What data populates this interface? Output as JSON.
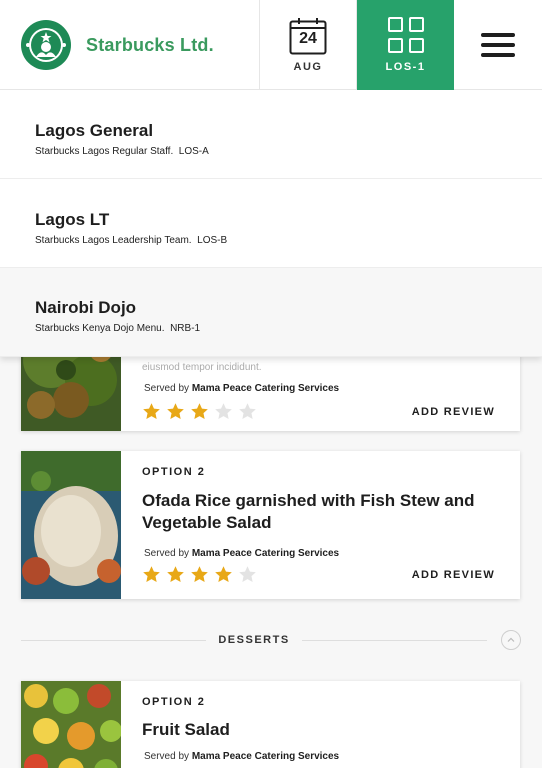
{
  "header": {
    "brand_name": "Starbucks Ltd.",
    "date_day": "24",
    "date_month": "AUG",
    "location_code": "LOS-1",
    "brand_color": "#27a26b"
  },
  "locations": [
    {
      "name": "Lagos General",
      "description": "Starbucks Lagos Regular Staff.",
      "code": "LOS-A"
    },
    {
      "name": "Lagos LT",
      "description": "Starbucks Lagos Leadership Team.",
      "code": "LOS-B"
    },
    {
      "name": "Nairobi Dojo",
      "description": "Starbucks Kenya Dojo Menu.",
      "code": "NRB-1"
    }
  ],
  "meals": [
    {
      "description_partial": "eiusmod tempor incididunt.",
      "served_prefix": "Served by",
      "vendor": "Mama Peace Catering Services",
      "rating": 3,
      "rating_max": 5,
      "add_review": "ADD REVIEW"
    },
    {
      "option": "OPTION 2",
      "title": "Ofada Rice garnished with Fish Stew and Vegetable Salad",
      "served_prefix": "Served by",
      "vendor": "Mama Peace Catering Services",
      "rating": 4,
      "rating_max": 5,
      "add_review": "ADD REVIEW"
    },
    {
      "option": "OPTION 2",
      "title": "Fruit Salad",
      "served_prefix": "Served by",
      "vendor": "Mama Peace Catering Services"
    }
  ],
  "section": {
    "label": "DESSERTS"
  },
  "colors": {
    "star_filled": "#e8a817",
    "star_empty": "#e3e3e3"
  }
}
